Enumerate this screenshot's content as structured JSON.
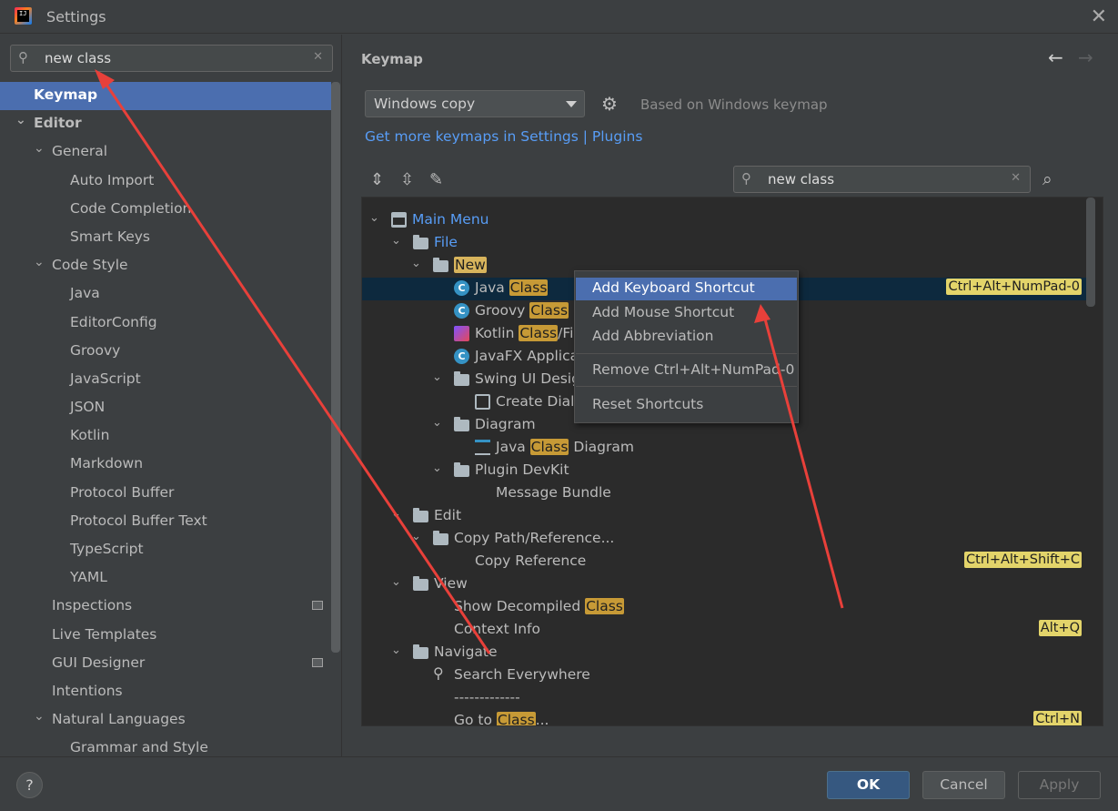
{
  "window": {
    "title": "Settings",
    "close_glyph": "✕"
  },
  "left": {
    "search": {
      "value": "new class",
      "clear": "✕"
    },
    "tree": [
      {
        "label": "Keymap",
        "level": 0,
        "selected": true
      },
      {
        "label": "Editor",
        "level": 0,
        "expanded": true
      },
      {
        "label": "General",
        "level": 1,
        "expanded": true
      },
      {
        "label": "Auto Import",
        "level": 2
      },
      {
        "label": "Code Completion",
        "level": 2
      },
      {
        "label": "Smart Keys",
        "level": 2
      },
      {
        "label": "Code Style",
        "level": 1,
        "expanded": true
      },
      {
        "label": "Java",
        "level": 2
      },
      {
        "label": "EditorConfig",
        "level": 2
      },
      {
        "label": "Groovy",
        "level": 2
      },
      {
        "label": "JavaScript",
        "level": 2
      },
      {
        "label": "JSON",
        "level": 2
      },
      {
        "label": "Kotlin",
        "level": 2
      },
      {
        "label": "Markdown",
        "level": 2
      },
      {
        "label": "Protocol Buffer",
        "level": 2
      },
      {
        "label": "Protocol Buffer Text",
        "level": 2
      },
      {
        "label": "TypeScript",
        "level": 2
      },
      {
        "label": "YAML",
        "level": 2
      },
      {
        "label": "Inspections",
        "level": 1
      },
      {
        "label": "Live Templates",
        "level": 1
      },
      {
        "label": "GUI Designer",
        "level": 1
      },
      {
        "label": "Intentions",
        "level": 1
      },
      {
        "label": "Natural Languages",
        "level": 1,
        "expanded": true
      },
      {
        "label": "Grammar and Style",
        "level": 2
      }
    ]
  },
  "right": {
    "title": "Keymap",
    "keymap_combo": "Windows copy",
    "based_on": "Based on Windows keymap",
    "link": "Get more keymaps in Settings | Plugins",
    "search": {
      "value": "new class",
      "clear": "✕"
    },
    "rows": [
      {
        "label": "Main Menu",
        "blue": true
      },
      {
        "label": "File",
        "blue": true
      },
      {
        "label_pre": "",
        "hl": "New",
        "label_post": ""
      },
      {
        "label_pre": "Java ",
        "hl": "Class",
        "label_post": "",
        "shortcut": "Ctrl+Alt+NumPad-0",
        "selected": true
      },
      {
        "label_pre": "Groovy ",
        "hl": "Class",
        "label_post": ""
      },
      {
        "label_pre": "Kotlin ",
        "hl": "Class",
        "label_post": "/File"
      },
      {
        "label": "JavaFX Applicat"
      },
      {
        "label": "Swing UI Desig"
      },
      {
        "label": "Create Dialo"
      },
      {
        "label": "Diagram"
      },
      {
        "label_pre": "Java ",
        "hl": "Class",
        "label_post": " Diagram"
      },
      {
        "label": "Plugin DevKit"
      },
      {
        "label": "Message Bundle"
      },
      {
        "label": "Edit"
      },
      {
        "label": "Copy Path/Reference..."
      },
      {
        "label": "Copy Reference",
        "shortcut": "Ctrl+Alt+Shift+C"
      },
      {
        "label": "View"
      },
      {
        "label_pre": "Show Decompiled ",
        "hl": "Class",
        "label_post": ""
      },
      {
        "label": "Context Info",
        "shortcut": "Alt+Q"
      },
      {
        "label": "Navigate"
      },
      {
        "label": "Search Everywhere"
      },
      {
        "label": "-------------"
      },
      {
        "label_pre": "Go to ",
        "hl": "Class",
        "label_post": "...",
        "shortcut": "Ctrl+N"
      }
    ]
  },
  "context_menu": {
    "items": [
      "Add Keyboard Shortcut",
      "Add Mouse Shortcut",
      "Add Abbreviation",
      "Remove Ctrl+Alt+NumPad-0",
      "Reset Shortcuts"
    ]
  },
  "buttons": {
    "help": "?",
    "ok": "OK",
    "cancel": "Cancel",
    "apply": "Apply"
  },
  "colors": {
    "accent": "#4b6eaf",
    "annotation_arrow": "#e8403a",
    "highlight": "#c79a36"
  },
  "icons": [
    "app-icon",
    "search-icon",
    "clear-icon",
    "chevron-down-icon",
    "back-arrow-icon",
    "forward-arrow-icon",
    "gear-icon",
    "expand-all-icon",
    "collapse-all-icon",
    "edit-icon",
    "find-shortcut-icon",
    "folder-icon",
    "class-icon",
    "help-icon"
  ]
}
